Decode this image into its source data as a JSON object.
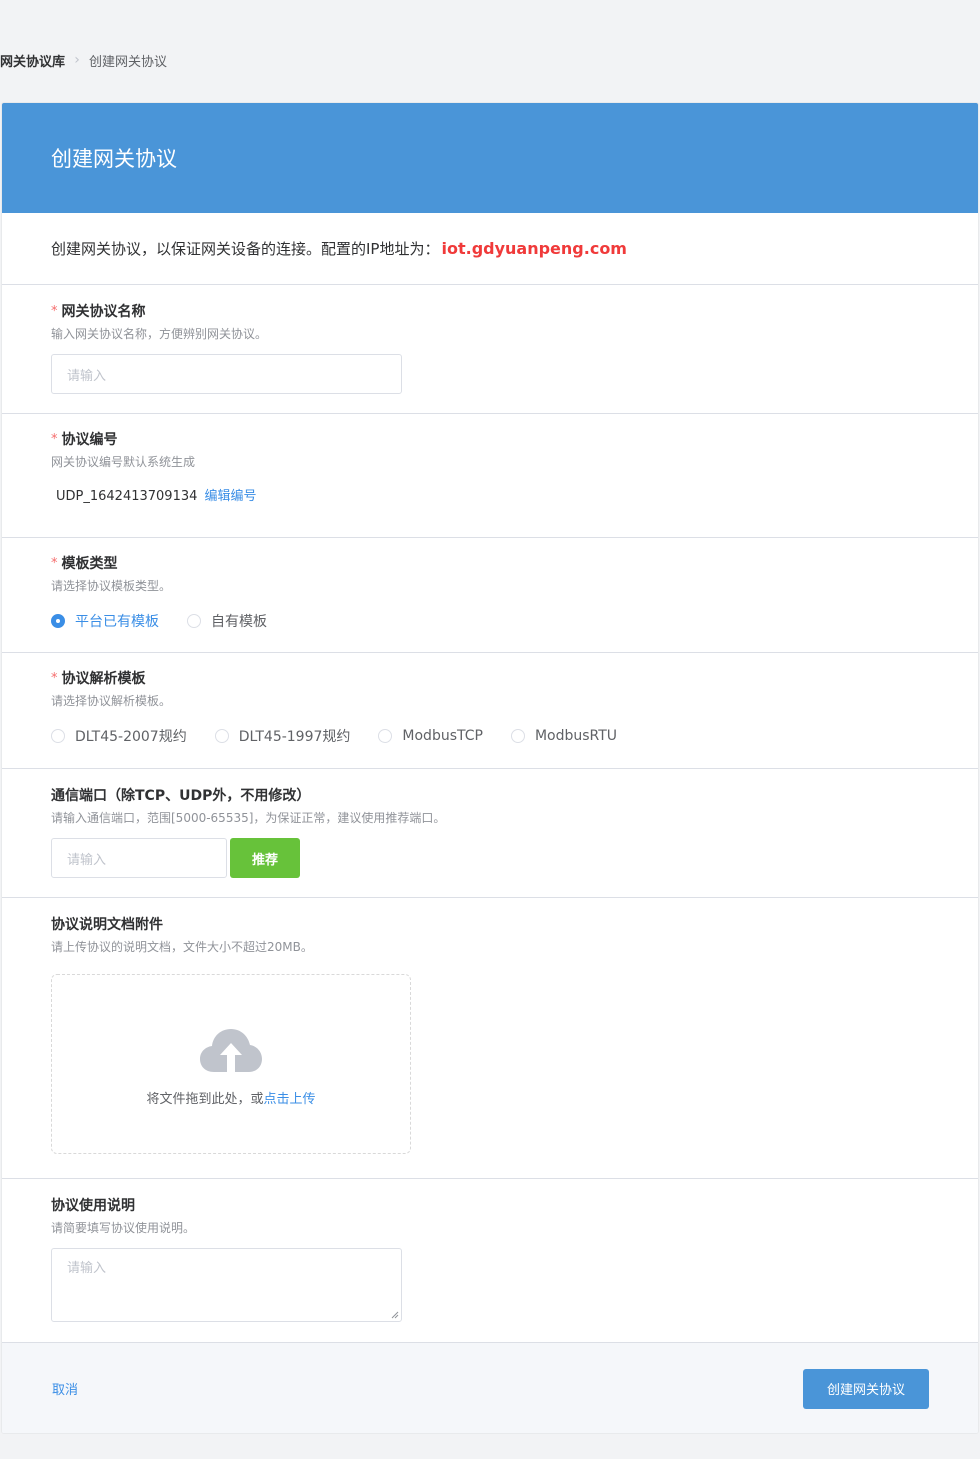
{
  "breadcrumb": {
    "root": "网关协议库",
    "current": "创建网关协议"
  },
  "header": {
    "title": "创建网关协议"
  },
  "intro": {
    "text": "创建网关协议，以保证网关设备的连接。配置的IP地址为：",
    "ip": "iot.gdyuanpeng.com"
  },
  "name_field": {
    "label": "网关协议名称",
    "hint": "输入网关协议名称，方便辨别网关协议。",
    "placeholder": "请输入"
  },
  "code_field": {
    "label": "协议编号",
    "hint": "网关协议编号默认系统生成",
    "value": "UDP_1642413709134",
    "edit_label": "编辑编号"
  },
  "template_type": {
    "label": "模板类型",
    "hint": "请选择协议模板类型。",
    "options": [
      "平台已有模板",
      "自有模板"
    ],
    "selected": "平台已有模板"
  },
  "parse_template": {
    "label": "协议解析模板",
    "hint": "请选择协议解析模板。",
    "options": [
      "DLT45-2007规约",
      "DLT45-1997规约",
      "ModbusTCP",
      "ModbusRTU"
    ]
  },
  "port_field": {
    "label": "通信端口（除TCP、UDP外，不用修改）",
    "hint": "请输入通信端口，范围[5000-65535]，为保证正常，建议使用推荐端口。",
    "placeholder": "请输入",
    "recommend_label": "推荐"
  },
  "doc_field": {
    "label": "协议说明文档附件",
    "hint": "请上传协议的说明文档，文件大小不超过20MB。",
    "upload_text": "将文件拖到此处，或",
    "upload_link": "点击上传",
    "icon": "cloud-upload-icon"
  },
  "usage_field": {
    "label": "协议使用说明",
    "hint": "请简要填写协议使用说明。",
    "placeholder": "请输入"
  },
  "footer": {
    "cancel_label": "取消",
    "submit_label": "创建网关协议"
  },
  "colors": {
    "primary": "#4a95d8",
    "link": "#3a8ee6",
    "success": "#67c23a",
    "required": "#f56c6c",
    "ip_highlight": "#f03a3a"
  }
}
